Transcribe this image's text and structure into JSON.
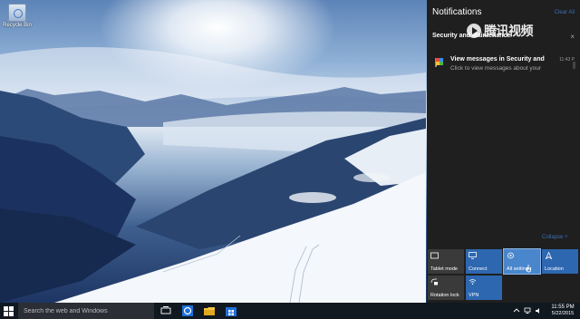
{
  "desktop": {
    "icons": [
      {
        "label": "Recycle Bin",
        "icon": "recycle-bin-icon"
      }
    ]
  },
  "action_center": {
    "title": "Notifications",
    "clear_all": "Clear All",
    "watermark_text": "腾讯视频",
    "group": {
      "title": "Security and Maintenance",
      "close": "×"
    },
    "notification": {
      "title": "View messages in Security and",
      "time": "11:43 P",
      "body": "Click to view messages about your"
    },
    "collapse": "Collapse ˅",
    "quick_actions": [
      {
        "label": "Tablet mode",
        "icon": "tablet-mode-icon",
        "state": "off"
      },
      {
        "label": "Connect",
        "icon": "connect-icon",
        "state": "on"
      },
      {
        "label": "All settings",
        "icon": "gear-icon",
        "state": "hover"
      },
      {
        "label": "Location",
        "icon": "location-icon",
        "state": "on"
      },
      {
        "label": "Rotation lock",
        "icon": "rotation-lock-icon",
        "state": "off"
      },
      {
        "label": "VPN",
        "icon": "vpn-icon",
        "state": "on"
      }
    ]
  },
  "taskbar": {
    "search_placeholder": "Search the web and Windows",
    "apps": [
      "task-view-icon",
      "edge-icon",
      "file-explorer-icon",
      "store-icon"
    ],
    "clock": {
      "time": "11:55 PM",
      "date": "5/22/2015"
    }
  },
  "colors": {
    "accent": "#2d67b0",
    "action_center_bg": "#1f1f1f",
    "taskbar_bg": "#101820"
  }
}
